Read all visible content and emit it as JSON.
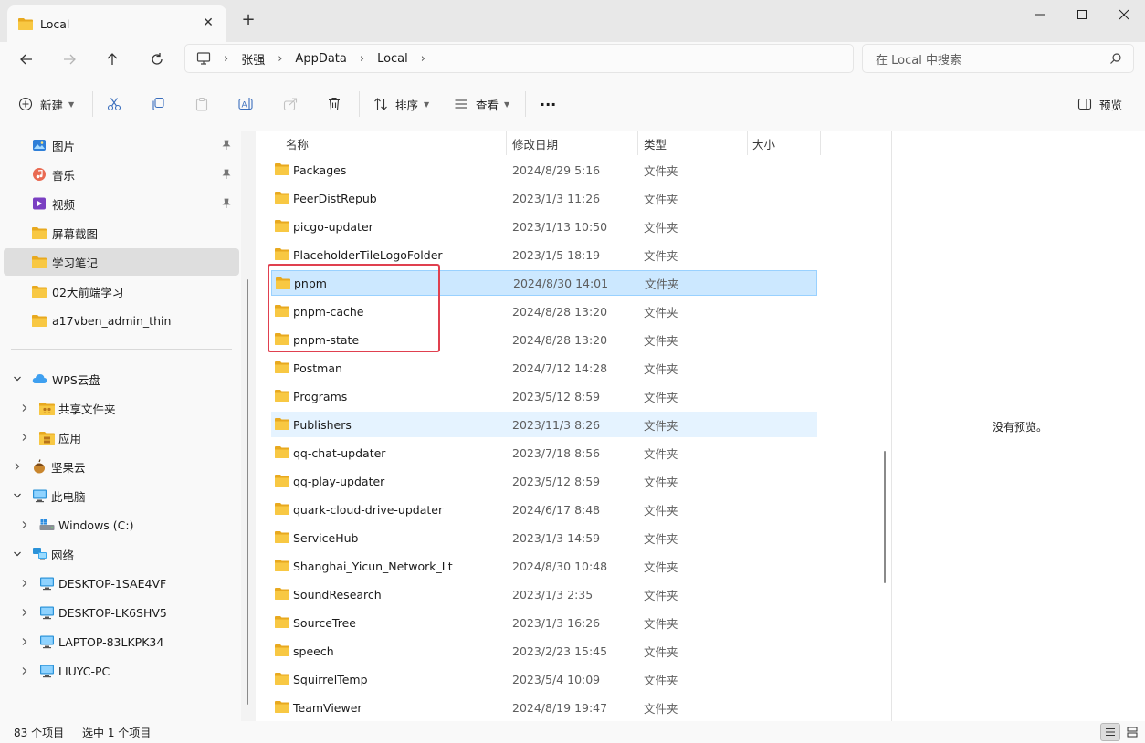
{
  "window": {
    "tab_title": "Local",
    "new_tab": "+",
    "close_tab": "✕"
  },
  "nav": {
    "breadcrumbs": [
      "张强",
      "AppData",
      "Local"
    ],
    "search_placeholder": "在 Local 中搜索"
  },
  "toolbar": {
    "new_label": "新建",
    "sort_label": "排序",
    "view_label": "查看",
    "more_label": "···",
    "preview_label": "预览"
  },
  "sidebar": {
    "quick_access": [
      {
        "label": "图片",
        "icon": "pictures-icon",
        "pinned": true
      },
      {
        "label": "音乐",
        "icon": "music-icon",
        "pinned": true
      },
      {
        "label": "视频",
        "icon": "videos-icon",
        "pinned": true
      },
      {
        "label": "屏幕截图",
        "icon": "folder-icon",
        "pinned": false
      },
      {
        "label": "学习笔记",
        "icon": "folder-icon",
        "pinned": false,
        "selected": true
      },
      {
        "label": "02大前端学习",
        "icon": "folder-icon",
        "pinned": false
      },
      {
        "label": "a17vben_admin_thin",
        "icon": "folder-icon",
        "pinned": false
      }
    ],
    "tree": [
      {
        "label": "WPS云盘",
        "icon": "wps-cloud-icon",
        "expanded": true,
        "level": 0
      },
      {
        "label": "共享文件夹",
        "icon": "shared-folder-icon",
        "expanded": false,
        "level": 1
      },
      {
        "label": "应用",
        "icon": "apps-folder-icon",
        "expanded": false,
        "level": 1
      },
      {
        "label": "坚果云",
        "icon": "nutstore-icon",
        "expanded": false,
        "level": 0
      },
      {
        "label": "此电脑",
        "icon": "this-pc-icon",
        "expanded": true,
        "level": 0
      },
      {
        "label": "Windows (C:)",
        "icon": "drive-icon",
        "expanded": false,
        "level": 1
      },
      {
        "label": "网络",
        "icon": "network-icon",
        "expanded": true,
        "level": 0
      },
      {
        "label": "DESKTOP-1SAE4VF",
        "icon": "computer-icon",
        "expanded": false,
        "level": 1
      },
      {
        "label": "DESKTOP-LK6SHV5",
        "icon": "computer-icon",
        "expanded": false,
        "level": 1
      },
      {
        "label": "LAPTOP-83LKPK34",
        "icon": "computer-icon",
        "expanded": false,
        "level": 1
      },
      {
        "label": "LIUYC-PC",
        "icon": "computer-icon",
        "expanded": false,
        "level": 1
      }
    ]
  },
  "file_list": {
    "columns": [
      "名称",
      "修改日期",
      "类型",
      "大小"
    ],
    "rows": [
      {
        "name": "Packages",
        "date": "2024/8/29 5:16",
        "type": "文件夹"
      },
      {
        "name": "PeerDistRepub",
        "date": "2023/1/3 11:26",
        "type": "文件夹"
      },
      {
        "name": "picgo-updater",
        "date": "2023/1/13 10:50",
        "type": "文件夹"
      },
      {
        "name": "PlaceholderTileLogoFolder",
        "date": "2023/1/5 18:19",
        "type": "文件夹"
      },
      {
        "name": "pnpm",
        "date": "2024/8/30 14:01",
        "type": "文件夹",
        "state": "selected"
      },
      {
        "name": "pnpm-cache",
        "date": "2024/8/28 13:20",
        "type": "文件夹"
      },
      {
        "name": "pnpm-state",
        "date": "2024/8/28 13:20",
        "type": "文件夹"
      },
      {
        "name": "Postman",
        "date": "2024/7/12 14:28",
        "type": "文件夹"
      },
      {
        "name": "Programs",
        "date": "2023/5/12 8:59",
        "type": "文件夹"
      },
      {
        "name": "Publishers",
        "date": "2023/11/3 8:26",
        "type": "文件夹",
        "state": "hover"
      },
      {
        "name": "qq-chat-updater",
        "date": "2023/7/18 8:56",
        "type": "文件夹"
      },
      {
        "name": "qq-play-updater",
        "date": "2023/5/12 8:59",
        "type": "文件夹"
      },
      {
        "name": "quark-cloud-drive-updater",
        "date": "2024/6/17 8:48",
        "type": "文件夹"
      },
      {
        "name": "ServiceHub",
        "date": "2023/1/3 14:59",
        "type": "文件夹"
      },
      {
        "name": "Shanghai_Yicun_Network_Lt",
        "date": "2024/8/30 10:48",
        "type": "文件夹"
      },
      {
        "name": "SoundResearch",
        "date": "2023/1/3 2:35",
        "type": "文件夹"
      },
      {
        "name": "SourceTree",
        "date": "2023/1/3 16:26",
        "type": "文件夹"
      },
      {
        "name": "speech",
        "date": "2023/2/23 15:45",
        "type": "文件夹"
      },
      {
        "name": "SquirrelTemp",
        "date": "2023/5/4 10:09",
        "type": "文件夹"
      },
      {
        "name": "TeamViewer",
        "date": "2024/8/19 19:47",
        "type": "文件夹"
      }
    ]
  },
  "preview": {
    "empty_text": "没有预览。"
  },
  "status": {
    "item_count": "83 个项目",
    "selected_count": "选中 1 个项目"
  },
  "colors": {
    "selection_bg": "#cce8ff",
    "selection_border": "#99d1ff",
    "hover_bg": "#e5f3ff",
    "folder_yellow": "#f8c843",
    "annotation_red": "#e0404f"
  }
}
